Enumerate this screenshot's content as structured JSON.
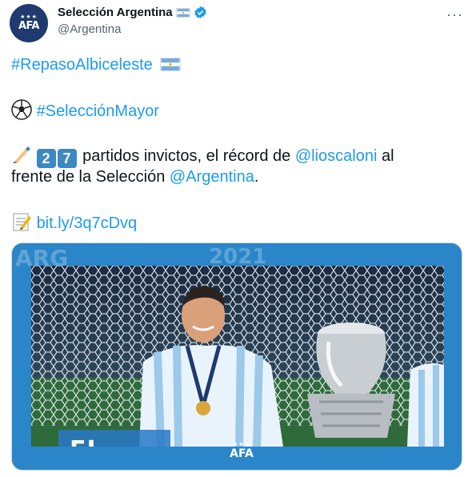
{
  "account": {
    "display_name": "Selección Argentina",
    "handle": "@Argentina",
    "avatar_logo_text": "AFA"
  },
  "more_label": "···",
  "tweet": {
    "hashtag1": "#RepasoAlbiceleste",
    "hashtag2": "#SelecciónMayor",
    "key1": "2",
    "key2": "7",
    "text_part1": " partidos invictos, el récord de ",
    "mention1": "@lioscaloni",
    "text_part2": " al",
    "text_line2_prefix": "frente de la Selección ",
    "mention2": "@Argentina",
    "text_line2_suffix": ".",
    "short_link": "bit.ly/3q7cDvq"
  },
  "media": {
    "year_text": "2021",
    "arg_text": "ARG",
    "banner_text": "EL CON",
    "logo_text": "AFA"
  },
  "colors": {
    "link": "#1d9bf0",
    "media_frame": "#2a86c9",
    "afa_navy": "#1e3a6e"
  }
}
